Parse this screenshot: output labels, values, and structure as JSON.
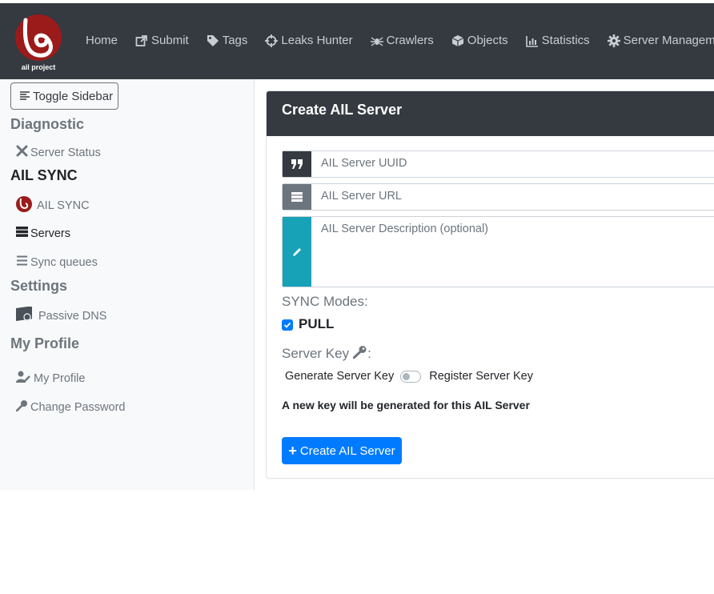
{
  "brand": {
    "logo_text": "ail project",
    "logo_color": "#9b1b1b"
  },
  "nav": [
    {
      "label": "Home",
      "icon": "none"
    },
    {
      "label": "Submit",
      "icon": "external-link-icon"
    },
    {
      "label": "Tags",
      "icon": "tag-icon"
    },
    {
      "label": "Leaks Hunter",
      "icon": "crosshairs-icon"
    },
    {
      "label": "Crawlers",
      "icon": "spider-icon"
    },
    {
      "label": "Objects",
      "icon": "cube-icon"
    },
    {
      "label": "Statistics",
      "icon": "chart-icon"
    },
    {
      "label": "Server Management",
      "icon": "gear-icon"
    }
  ],
  "sidebar": {
    "toggle_label": "Toggle Sidebar",
    "sections": {
      "diagnostic": "Diagnostic",
      "ail_sync": "AIL SYNC",
      "settings": "Settings",
      "my_profile": "My Profile"
    },
    "items": {
      "server_status": "Server Status",
      "ail_sync": "AIL SYNC",
      "servers": "Servers",
      "sync_queues": "Sync queues",
      "passive_dns": "Passive DNS",
      "my_profile": "My Profile",
      "change_password": "Change Password"
    }
  },
  "form": {
    "title": "Create AIL Server",
    "uuid_placeholder": "AIL Server UUID",
    "url_placeholder": "AIL Server URL",
    "description_placeholder": "AIL Server Description (optional)",
    "sync_modes_label": "SYNC Modes:",
    "pull_label": "PULL",
    "pull_checked": true,
    "server_key_label": "Server Key",
    "generate_key_label": "Generate Server Key",
    "register_key_label": "Register Server Key",
    "register_key_enabled": false,
    "key_notice": "A new key will be generated for this AIL Server",
    "submit_label": "Create AIL Server"
  },
  "colors": {
    "accent": "#007bff",
    "topbar": "#343a40",
    "teal": "#17a2b8",
    "gray_addon": "#6c757d"
  }
}
